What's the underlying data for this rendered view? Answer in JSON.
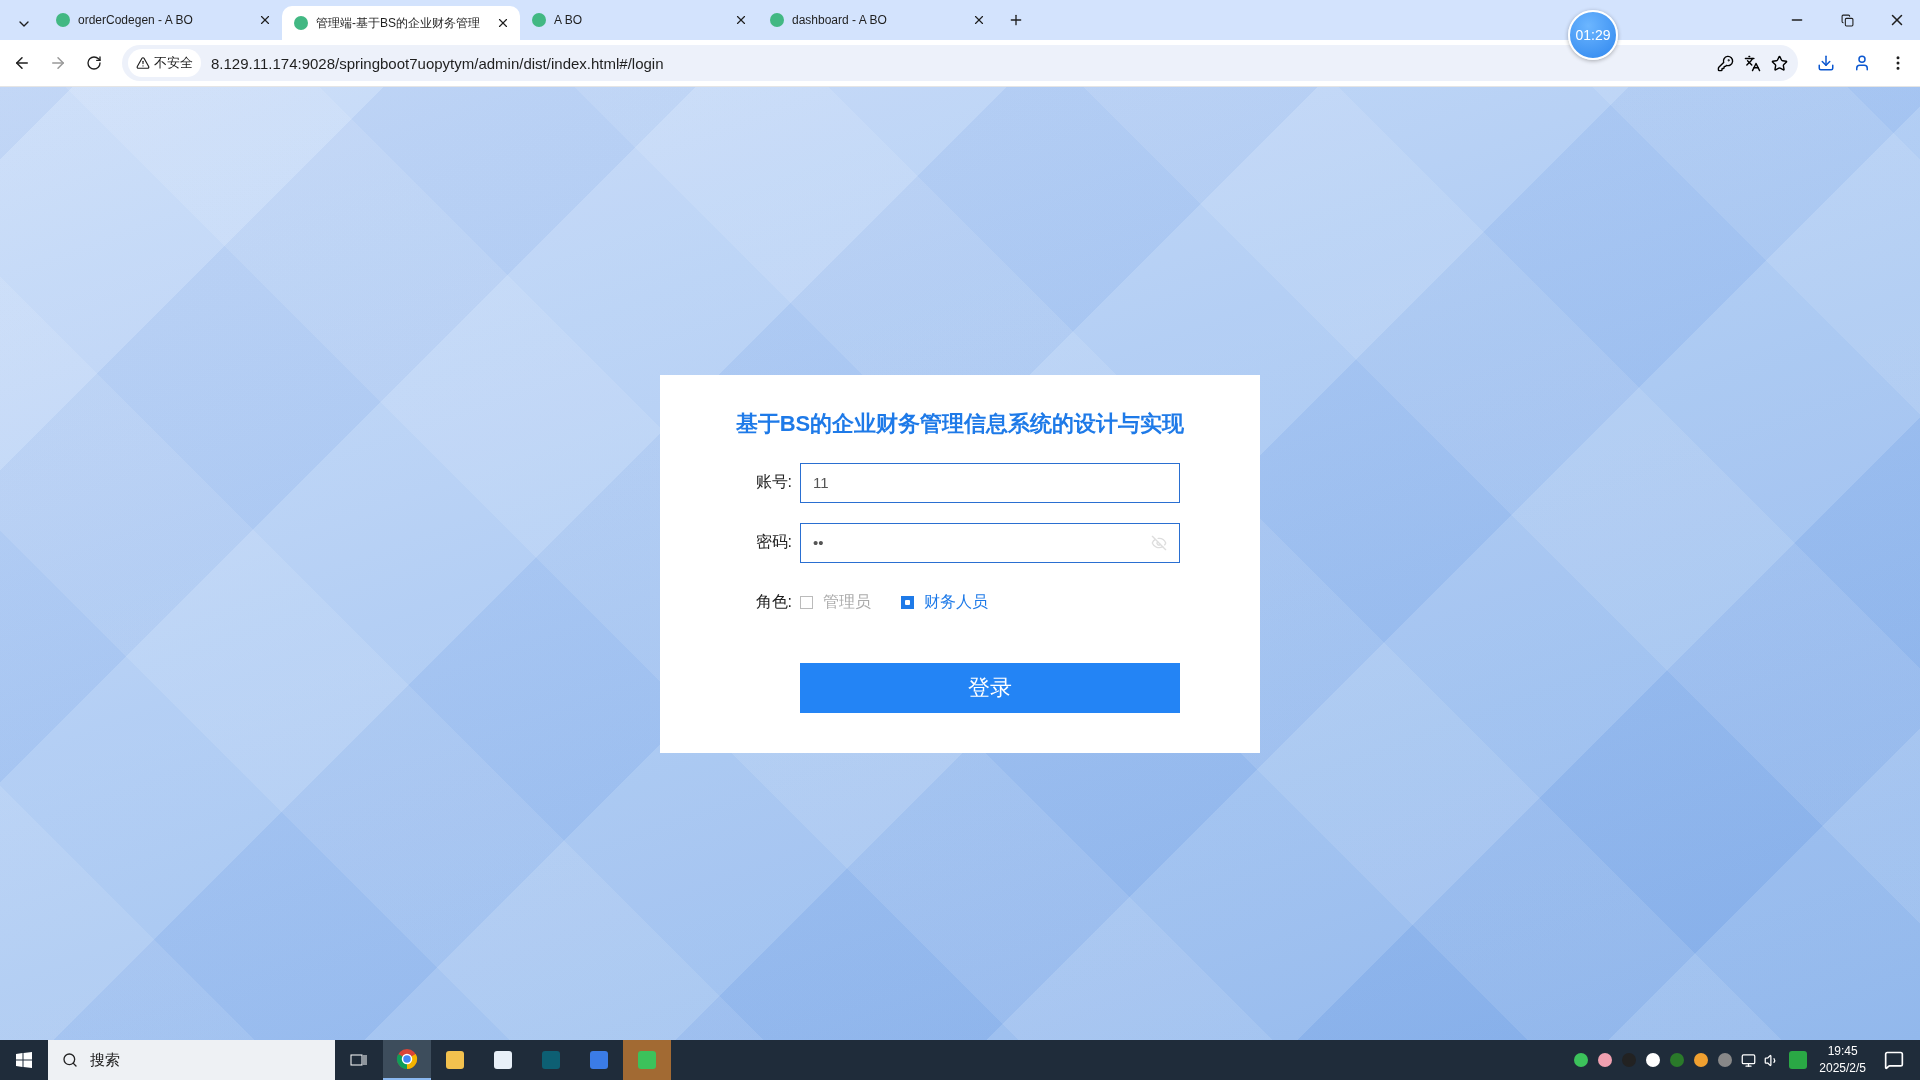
{
  "browser": {
    "tabs": [
      {
        "title": "orderCodegen - A BO",
        "selected": false
      },
      {
        "title": "管理端-基于BS的企业财务管理",
        "selected": true
      },
      {
        "title": "A BO",
        "selected": false
      },
      {
        "title": "dashboard - A BO",
        "selected": false
      }
    ],
    "security_label": "不安全",
    "url": "8.129.11.174:9028/springboot7uopytym/admin/dist/index.html#/login",
    "timer": "01:29"
  },
  "login": {
    "title": "基于BS的企业财务管理信息系统的设计与实现",
    "fields": [
      {
        "label": "账号:",
        "value": "11",
        "kind": "text"
      },
      {
        "label": "密码:",
        "value": "••",
        "kind": "password"
      }
    ],
    "role_label": "角色:",
    "roles": [
      {
        "label": "管理员",
        "checked": false
      },
      {
        "label": "财务人员",
        "checked": true
      }
    ],
    "submit": "登录"
  },
  "taskbar": {
    "search_placeholder": "搜索",
    "time": "19:45",
    "date": "2025/2/5"
  }
}
